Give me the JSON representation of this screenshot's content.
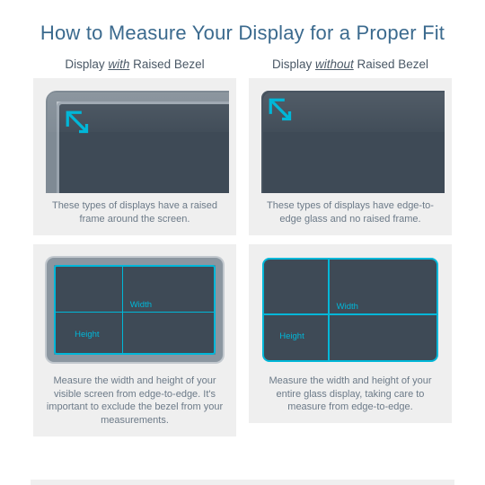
{
  "title": "How to Measure Your Display for a Proper Fit",
  "left": {
    "heading_pre": "Display ",
    "heading_em": "with",
    "heading_post": " Raised Bezel",
    "caption1": "These types of displays have a raised frame around the screen.",
    "width_label": "Width",
    "height_label": "Height",
    "caption2": "Measure the width and height of your visible screen from edge-to-edge. It's important to exclude the bezel from your measurements."
  },
  "right": {
    "heading_pre": "Display ",
    "heading_em": "without",
    "heading_post": " Raised Bezel",
    "caption1": "These types of displays have edge-to-edge glass and no raised frame.",
    "width_label": "Width",
    "height_label": "Height",
    "caption2": "Measure the width and height of your entire glass display, taking care to measure from edge-to-edge."
  }
}
